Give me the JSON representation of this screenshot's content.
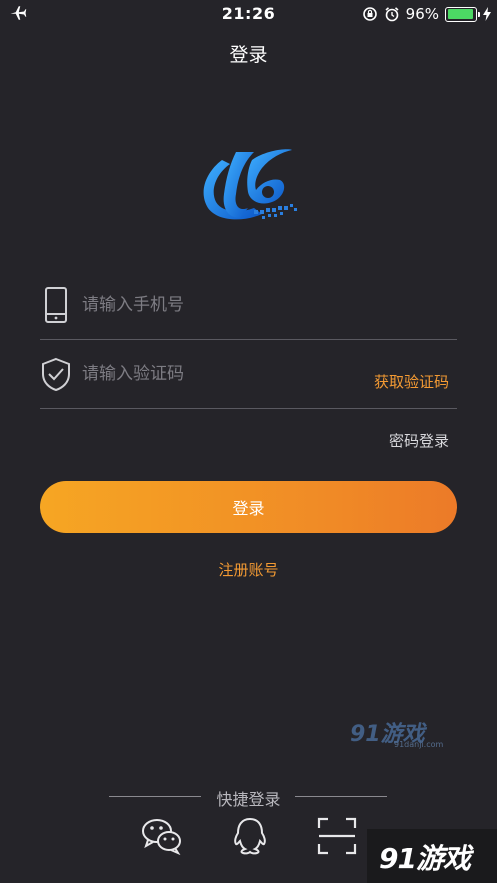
{
  "status_bar": {
    "time": "21:26",
    "battery_percent": "96%",
    "battery_level": 0.96,
    "icons": [
      "airplane-icon",
      "rotation-lock-icon",
      "alarm-icon",
      "battery-icon",
      "charging-icon"
    ]
  },
  "nav": {
    "title": "登录"
  },
  "form": {
    "phone_placeholder": "请输入手机号",
    "code_placeholder": "请输入验证码",
    "get_code_label": "获取验证码",
    "password_login_label": "密码登录",
    "login_button_label": "登录",
    "register_label": "注册账号"
  },
  "quick_login": {
    "label": "快捷登录",
    "options": [
      "wechat-icon",
      "qq-icon",
      "scan-icon"
    ]
  },
  "watermarks": {
    "mid_logo": "91游戏",
    "mid_url": "91danji.com",
    "corner": "91游戏"
  },
  "colors": {
    "background": "#252429",
    "accent": "#f39a33",
    "button_gradient_start": "#f6a623",
    "button_gradient_end": "#ec7a28",
    "battery": "#4cd964"
  }
}
